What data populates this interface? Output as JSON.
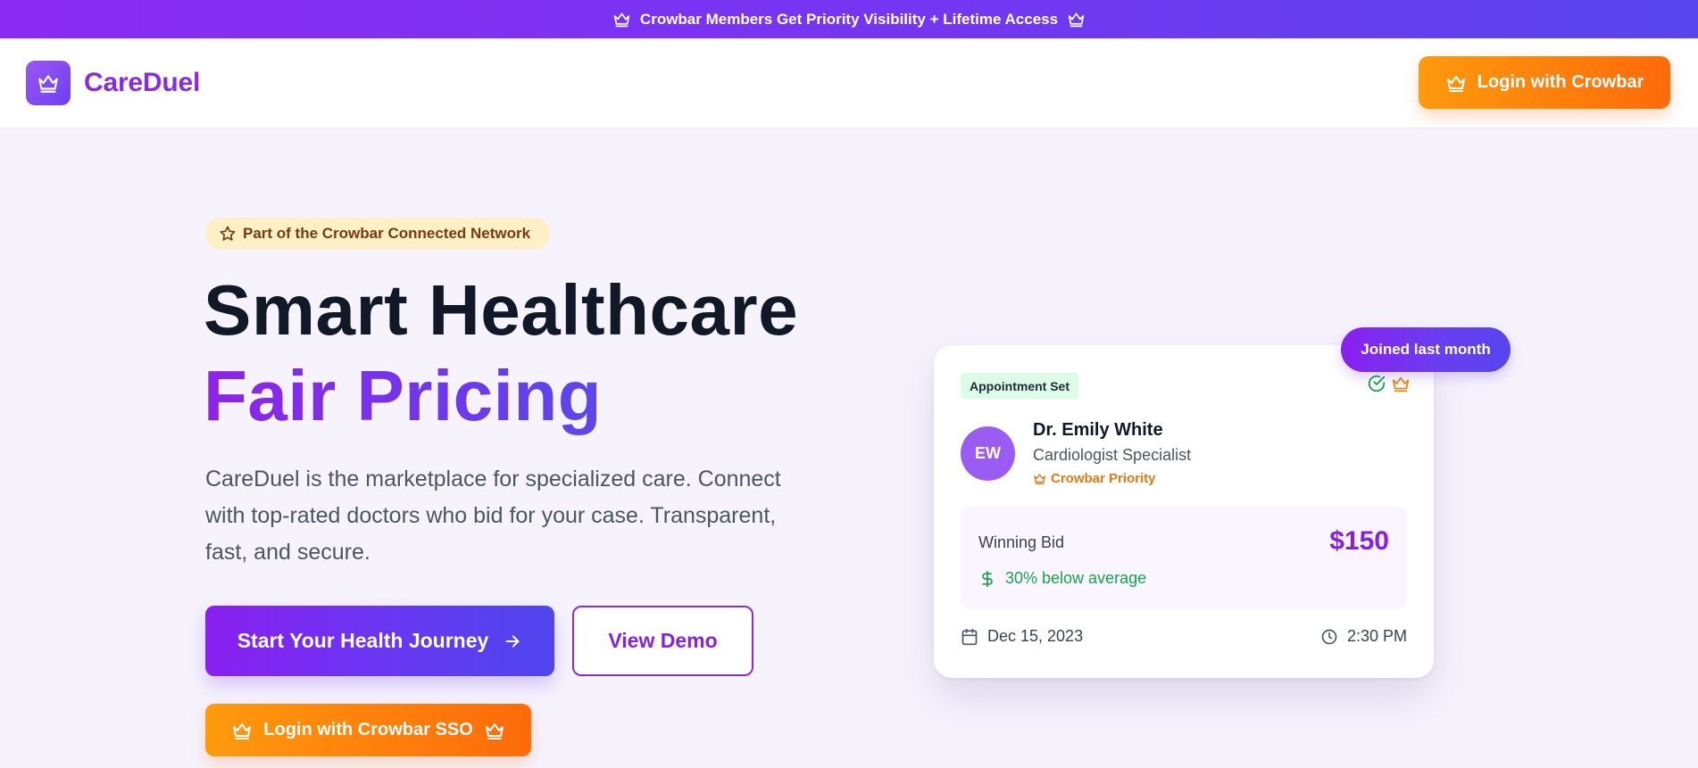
{
  "banner": {
    "text": "Crowbar Members Get Priority Visibility + Lifetime Access",
    "icon": "crown-icon"
  },
  "navbar": {
    "brand": "CareDuel",
    "logo_icon": "crown-icon",
    "login_label": "Login with Crowbar"
  },
  "hero": {
    "network_badge": "Part of the Crowbar Connected Network",
    "headline_line1": "Smart Healthcare",
    "headline_line2": "Fair Pricing",
    "description": "CareDuel is the marketplace for specialized care. Connect with top-rated doctors who bid for your case. Transparent, fast, and secure.",
    "primary_cta": "Start Your Health Journey",
    "secondary_cta": "View Demo",
    "sso_cta": "Login with Crowbar SSO"
  },
  "card": {
    "joined_badge": "Joined last month",
    "status": "Appointment Set",
    "avatar_initials": "EW",
    "doctor_name": "Dr. Emily White",
    "specialty": "Cardiologist Specialist",
    "priority_label": "Crowbar Priority",
    "bid_label": "Winning Bid",
    "bid_amount": "$150",
    "savings": "30% below average",
    "date": "Dec 15, 2023",
    "time": "2:30 PM"
  },
  "colors": {
    "brand_purple": "#8a2be2",
    "accent_orange": "#ff7a0a",
    "banner_gradient_start": "#8b2bf3",
    "banner_gradient_end": "#5945ee",
    "success_green": "#16a34a",
    "page_background": "#f6f3fd"
  }
}
